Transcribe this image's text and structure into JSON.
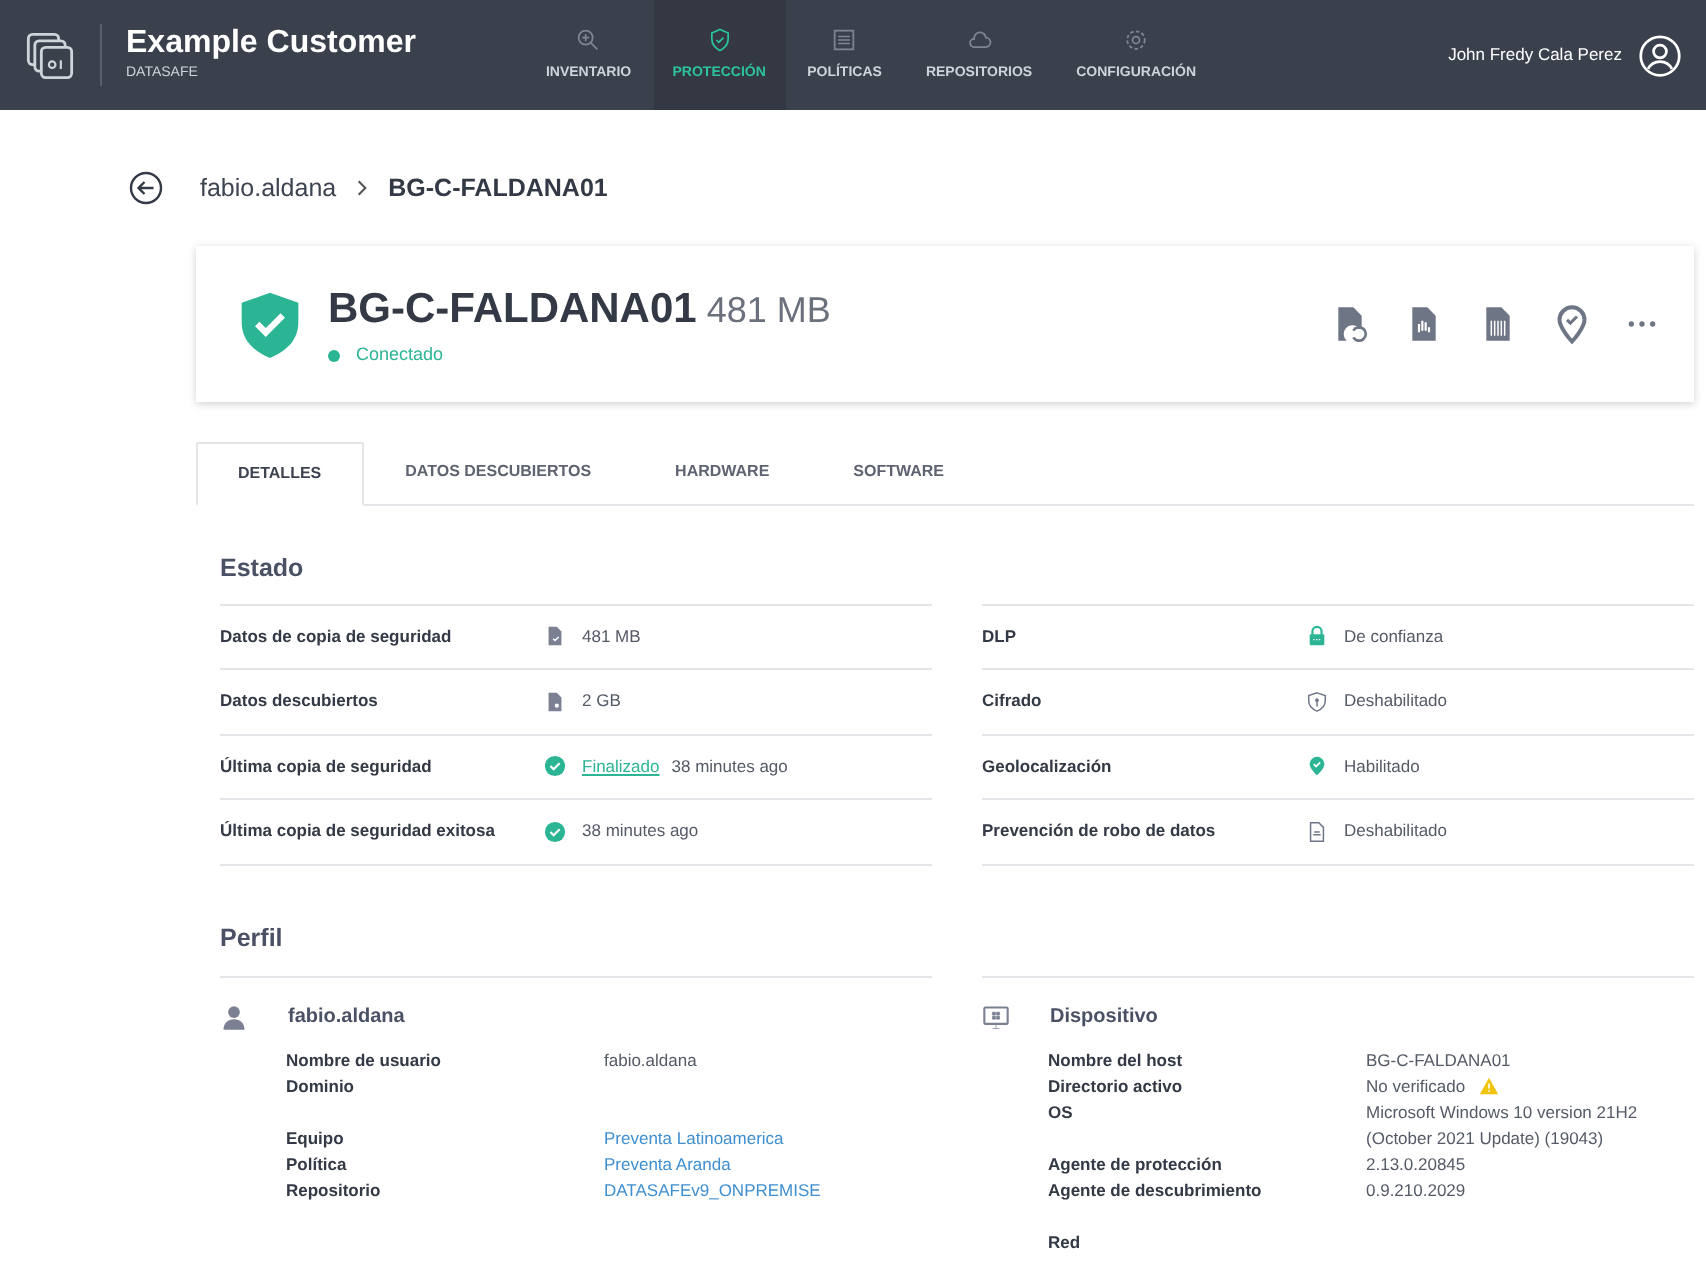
{
  "header": {
    "title": "Example Customer",
    "subtitle": "DATASAFE",
    "nav": [
      {
        "label": "INVENTARIO",
        "kind": "zoom",
        "selected": false
      },
      {
        "label": "PROTECCIÓN",
        "kind": "shield",
        "selected": true
      },
      {
        "label": "POLÍTICAS",
        "kind": "list",
        "selected": false
      },
      {
        "label": "REPOSITORIOS",
        "kind": "cloud",
        "selected": false
      },
      {
        "label": "CONFIGURACIÓN",
        "kind": "gear",
        "selected": false
      }
    ],
    "user": "John Fredy Cala Perez"
  },
  "breadcrumb": [
    "fabio.aldana",
    "BG-C-FALDANA01"
  ],
  "device": {
    "name": "BG-C-FALDANA01",
    "size": "481 MB",
    "status": "Conectado"
  },
  "tabs": [
    {
      "label": "DETALLES",
      "selected": true
    },
    {
      "label": "DATOS DESCUBIERTOS",
      "selected": false
    },
    {
      "label": "HARDWARE",
      "selected": false
    },
    {
      "label": "SOFTWARE",
      "selected": false
    }
  ],
  "estado": {
    "title": "Estado",
    "left": [
      {
        "label": "Datos de copia de seguridad",
        "kind": "backup",
        "value": "481 MB"
      },
      {
        "label": "Datos descubiertos",
        "kind": "discover",
        "value": "2 GB"
      },
      {
        "label": "Última copia de seguridad",
        "kind": "check",
        "link": "Finalizado",
        "value": "38 minutes ago"
      },
      {
        "label": "Última copia de seguridad exitosa",
        "kind": "check",
        "value": "38 minutes ago"
      }
    ],
    "right": [
      {
        "label": "DLP",
        "kind": "lock",
        "value": "De confianza"
      },
      {
        "label": "Cifrado",
        "kind": "shield",
        "value": "Deshabilitado"
      },
      {
        "label": "Geolocalización",
        "kind": "pin",
        "value": "Habilitado"
      },
      {
        "label": "Prevención de robo de datos",
        "kind": "doc",
        "value": "Deshabilitado"
      }
    ]
  },
  "perfil": {
    "title": "Perfil",
    "user": {
      "title": "fabio.aldana",
      "groups": [
        [
          {
            "label": "Nombre de usuario",
            "value": "fabio.aldana",
            "link": false
          },
          {
            "label": "Dominio"
          }
        ],
        [
          {
            "label": "Equipo",
            "value": "Preventa Latinoamerica",
            "link": true
          },
          {
            "label": "Política",
            "value": "Preventa Aranda",
            "link": true
          },
          {
            "label": "Repositorio",
            "value": "DATASAFEv9_ONPREMISE",
            "link": true
          }
        ]
      ]
    },
    "dispositivo": {
      "title": "Dispositivo",
      "groups": [
        [
          {
            "label": "Nombre del host",
            "value": "BG-C-FALDANA01",
            "warning": false
          },
          {
            "label": "Directorio activo",
            "value": "No verificado",
            "warning": true
          },
          {
            "label": "OS",
            "value": "Microsoft Windows 10 version 21H2 (October 2021 Update) (19043)",
            "warning": false
          },
          {
            "label": "Agente de protección",
            "value": "2.13.0.20845",
            "warning": false
          },
          {
            "label": "Agente de descubrimiento",
            "value": "0.9.210.2029",
            "warning": false
          }
        ],
        [
          {
            "label": "Red"
          }
        ]
      ]
    }
  }
}
